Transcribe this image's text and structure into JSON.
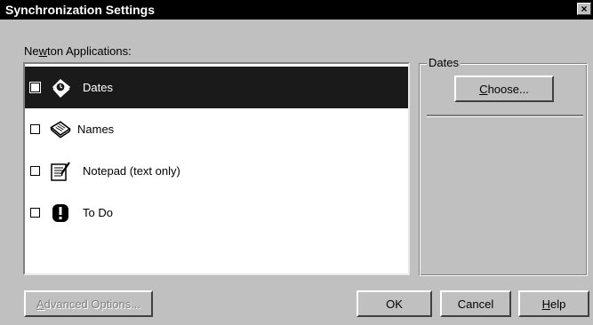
{
  "window": {
    "title": "Synchronization Settings",
    "close_glyph": "×"
  },
  "apps_label": {
    "before": "Ne",
    "mnemonic": "w",
    "after": "ton Applications:"
  },
  "apps": [
    {
      "label": "Dates",
      "icon": "dates-icon",
      "checked": false,
      "selected": true
    },
    {
      "label": "Names",
      "icon": "names-icon",
      "checked": false,
      "selected": false
    },
    {
      "label": "Notepad (text only)",
      "icon": "notepad-icon",
      "checked": false,
      "selected": false
    },
    {
      "label": "To Do",
      "icon": "todo-icon",
      "checked": false,
      "selected": false
    }
  ],
  "details": {
    "group_title": "Dates",
    "choose": {
      "mnemonic": "C",
      "after": "hoose..."
    }
  },
  "buttons": {
    "advanced": {
      "mnemonic": "A",
      "after": "dvanced Options..."
    },
    "ok": "OK",
    "cancel": "Cancel",
    "help": {
      "mnemonic": "H",
      "after": "elp"
    }
  }
}
